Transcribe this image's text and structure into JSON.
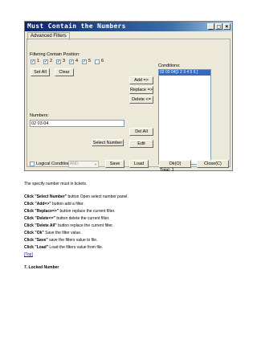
{
  "window": {
    "title": "Must Contain the Numbers",
    "tab": "Advanced Filters",
    "title_buttons": [
      "_",
      "□",
      "×"
    ]
  },
  "filter_pos": {
    "label": "Filtering Contain Position:",
    "checks": [
      {
        "label": "1",
        "checked": "✓"
      },
      {
        "label": "2",
        "checked": "✓"
      },
      {
        "label": "3",
        "checked": "✓"
      },
      {
        "label": "4",
        "checked": "✓"
      },
      {
        "label": "5",
        "checked": "✓"
      },
      {
        "label": "6",
        "checked": ""
      }
    ],
    "set_all": "Set All",
    "clear": "Clear"
  },
  "numbers": {
    "label": "Numbers:",
    "value": "02 03 04",
    "select_number": "Select Number"
  },
  "conditions": {
    "label": "Conditions:",
    "item": "02 03 04[1 2 3 4 5 6 ]",
    "total": "Total: 1"
  },
  "actions": {
    "add": "Add =>",
    "replace": "Replace =>",
    "delete": "Delete <=",
    "del_all": "Del All",
    "edit": "Edit"
  },
  "bottom": {
    "logical_label": "Logical Condition:",
    "logical_value": "AND",
    "save": "Save",
    "load": "Load",
    "ok": "Ok(O)",
    "close": "Close(C)"
  },
  "doc": {
    "intro": "The specify number must in tickets.",
    "lines": [
      {
        "b": "Click \"Select Number\"",
        "t": " button Open select number panel."
      },
      {
        "b": "Click \"Add=>\"",
        "t": " button add a filter."
      },
      {
        "b": "Click \"Replace=>\"",
        "t": " button replace the current filter."
      },
      {
        "b": "Click \"Delete<=\"",
        "t": " button delete the current filter."
      },
      {
        "b": "Click \"Delete All\"",
        "t": " button replace the current filter."
      },
      {
        "b": "Click \"Ok\"",
        "t": " Save the filter value."
      },
      {
        "b": "Click \"Save\"",
        "t": " save the filters value to file."
      },
      {
        "b": "Click \"Load\"",
        "t": " Load the filters value from file."
      }
    ],
    "top_link": "[Top]",
    "section": "7.  Locked Number"
  }
}
